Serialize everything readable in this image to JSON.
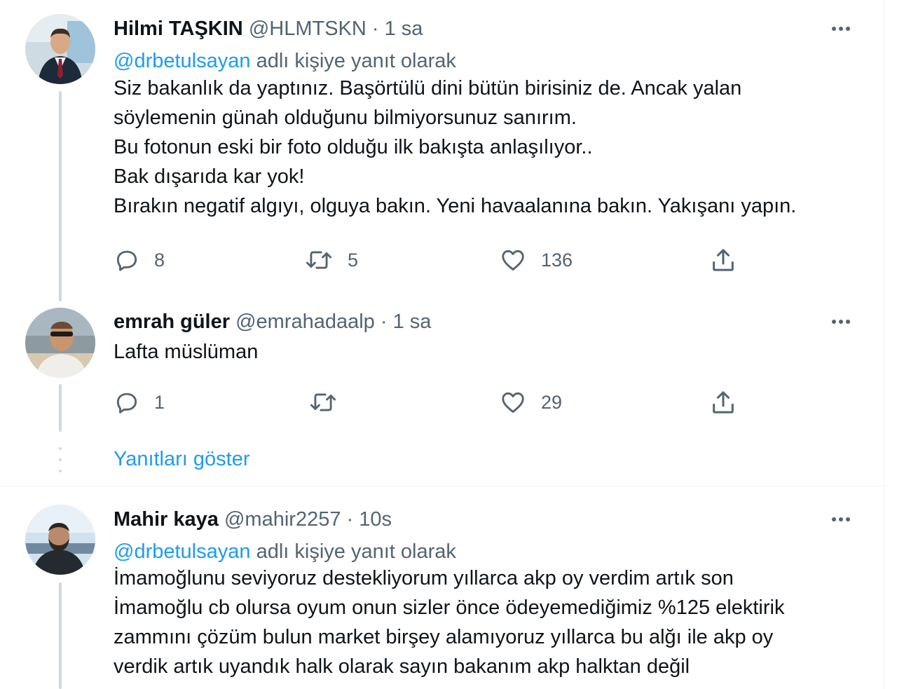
{
  "tweets": [
    {
      "name": "Hilmi TAŞKIN",
      "handle": "@HLMTSKN",
      "sep": "·",
      "time": "1 sa",
      "reply_to_handle": "@drbetulsayan",
      "reply_to_suffix": "adlı kişiye yanıt olarak",
      "lines": [
        "Siz bakanlık da yaptınız. Başörtülü dini bütün birisiniz de. Ancak yalan",
        "söylemenin günah olduğunu bilmiyorsunuz sanırım.",
        "Bu fotonun eski bir foto olduğu ilk bakışta anlaşılıyor..",
        "Bak dışarıda kar yok!",
        "Bırakın negatif algıyı, olguya bakın. Yeni havaalanına bakın. Yakışanı yapın."
      ],
      "replies": "8",
      "retweets": "5",
      "likes": "136"
    },
    {
      "name": "emrah güler",
      "handle": "@emrahadaalp",
      "sep": "·",
      "time": "1 sa",
      "lines": [
        "Lafta müslüman"
      ],
      "replies": "1",
      "retweets": "",
      "likes": "29"
    },
    {
      "name": "Mahir kaya",
      "handle": "@mahir2257",
      "sep": "·",
      "time": "10s",
      "reply_to_handle": "@drbetulsayan",
      "reply_to_suffix": "adlı kişiye yanıt olarak",
      "lines": [
        "İmamoğlunu seviyoruz destekliyorum yıllarca akp oy verdim artık son",
        "İmamoğlu cb olursa oyum onun sizler önce ödeyemediğimiz %125 elektirik",
        "zammını çözüm bulun market birşey alamıyoruz yıllarca bu alğı  ile akp oy",
        "verdik artık uyandık halk olarak sayın bakanım akp halktan değil"
      ]
    }
  ],
  "show_replies_label": "Yanıtları göster",
  "colors": {
    "accent": "#1d9bf0",
    "secondary_text": "#536471",
    "thread_line": "#cfd9de"
  },
  "icons": [
    "more-icon",
    "reply-icon",
    "retweet-icon",
    "like-icon",
    "share-icon"
  ]
}
